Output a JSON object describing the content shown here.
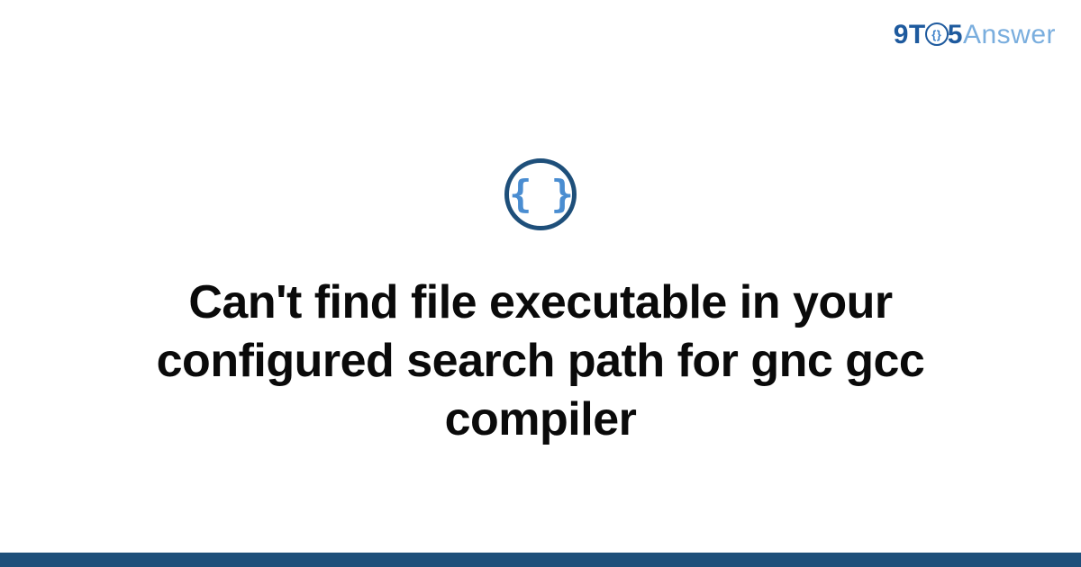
{
  "logo": {
    "part1": "9T",
    "inner": "{}",
    "part2": "5",
    "part3": "Answer"
  },
  "icon": {
    "glyph": "{ }",
    "name": "code-braces-icon"
  },
  "title": "Can't find file executable in your configured search path for gnc gcc compiler",
  "colors": {
    "brand_dark": "#1e4f7a",
    "brand_mid": "#1e5a9e",
    "brand_light": "#4a8dd1",
    "brand_pale": "#7aaede"
  }
}
